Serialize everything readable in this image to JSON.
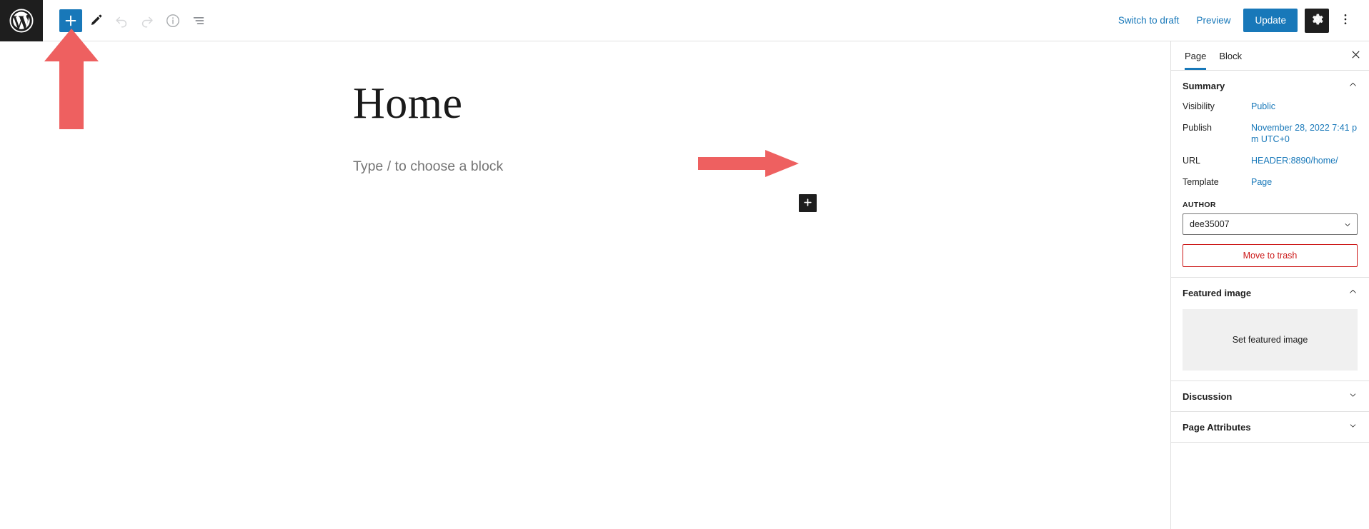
{
  "toolbar": {
    "logo_icon": "wordpress-logo-icon",
    "add_block_label": "+",
    "tools_icon": "pencil-tools-icon",
    "undo_icon": "undo-arrow-icon",
    "redo_icon": "redo-arrow-icon",
    "info_icon": "info-circle-icon",
    "list_view_icon": "list-view-icon",
    "switch_to_draft": "Switch to draft",
    "preview": "Preview",
    "update": "Update",
    "settings_icon": "gear-icon",
    "options_icon": "three-dots-vertical-icon"
  },
  "editor": {
    "title": "Home",
    "block_placeholder": "Type / to choose a block",
    "inline_add_icon": "plus-icon"
  },
  "annotations": {
    "arrow_color": "#EE6060",
    "arrow_up_name": "annotation-arrow-up",
    "arrow_right_name": "annotation-arrow-right"
  },
  "sidebar": {
    "tabs": [
      {
        "label": "Page",
        "active": true
      },
      {
        "label": "Block",
        "active": false
      }
    ],
    "close_icon": "close-x-icon",
    "panels": [
      {
        "title": "Summary",
        "expanded": true
      },
      {
        "title": "Featured image",
        "expanded": true
      },
      {
        "title": "Discussion",
        "expanded": false
      },
      {
        "title": "Page Attributes",
        "expanded": false
      }
    ],
    "summary": {
      "visibility_label": "Visibility",
      "visibility_value": "Public",
      "publish_label": "Publish",
      "publish_value": "November 28, 2022 7:41 pm UTC+0",
      "url_label": "URL",
      "url_value": "HEADER:8890/home/",
      "template_label": "Template",
      "template_value": "Page",
      "author_label": "AUTHOR",
      "author_value": "dee35007",
      "author_chevron_icon": "chevron-down-icon",
      "trash_label": "Move to trash"
    },
    "featured_image": {
      "set_label": "Set featured image"
    }
  },
  "colors": {
    "accent_blue": "#1878b9",
    "danger_red": "#cc1818",
    "dark": "#1e1e1e",
    "annotation": "#EE6060"
  }
}
